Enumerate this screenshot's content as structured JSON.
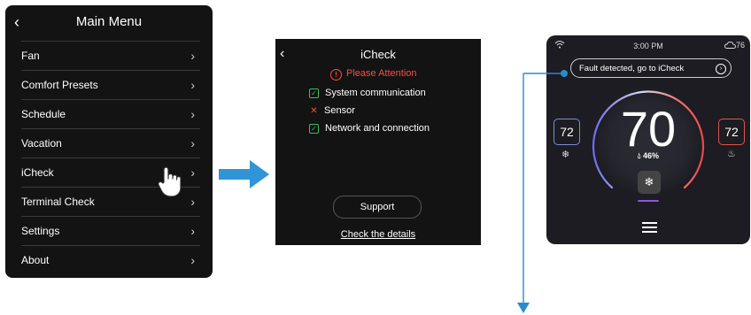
{
  "menu": {
    "title": "Main Menu",
    "back_glyph": "‹",
    "items": [
      {
        "label": "Fan"
      },
      {
        "label": "Comfort Presets"
      },
      {
        "label": "Schedule"
      },
      {
        "label": "Vacation"
      },
      {
        "label": "iCheck"
      },
      {
        "label": "Terminal Check"
      },
      {
        "label": "Settings"
      },
      {
        "label": "About"
      }
    ]
  },
  "icheck": {
    "title": "iCheck",
    "attention": "Please Attention",
    "items": [
      {
        "label": "System communication",
        "status": "ok"
      },
      {
        "label": "Sensor",
        "status": "fail"
      },
      {
        "label": "Network and connection",
        "status": "ok"
      }
    ],
    "support_label": "Support",
    "details_label": "Check the details"
  },
  "thermostat": {
    "time": "3:00 PM",
    "outdoor_temp": "76",
    "fault_text": "Fault detected, go to iCheck",
    "current_temp": "70",
    "humidity": "46%",
    "cool_setpoint": "72",
    "heat_setpoint": "72"
  },
  "colors": {
    "panel_bg": "#131313",
    "accent_arrow": "#2f95d6",
    "ok_green": "#3bbd5a",
    "alert_red": "#ff4a3d",
    "callout_blue": "#2a8bd0"
  },
  "icons": [
    "back-chevron-icon",
    "chevron-right-icon",
    "hand-pointer-icon",
    "wifi-icon",
    "cloud-icon",
    "snowflake-icon",
    "flame-icon",
    "droplet-icon",
    "fan-mode-icon",
    "menu-icon"
  ]
}
